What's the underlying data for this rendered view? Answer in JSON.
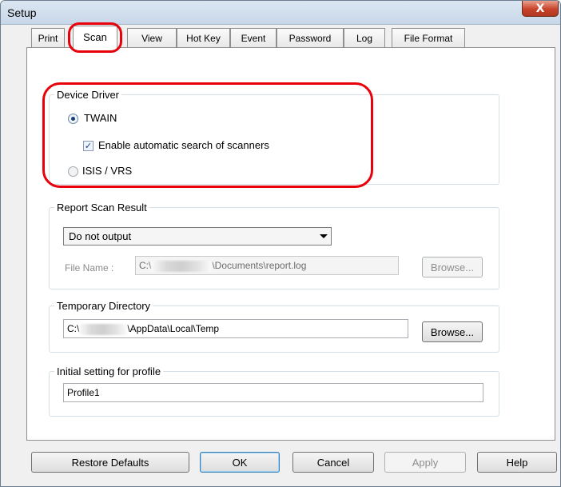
{
  "window": {
    "title": "Setup",
    "close_label": "X"
  },
  "tabs": [
    {
      "label": "Print"
    },
    {
      "label": "Scan"
    },
    {
      "label": "View"
    },
    {
      "label": "Hot Key"
    },
    {
      "label": "Event"
    },
    {
      "label": "Password"
    },
    {
      "label": "Log"
    },
    {
      "label": "File Format"
    }
  ],
  "active_tab": "Scan",
  "device_driver": {
    "legend": "Device Driver",
    "twain_label": "TWAIN",
    "twain_selected": true,
    "auto_search_label": "Enable automatic search of scanners",
    "auto_search_checked": true,
    "isis_label": "ISIS / VRS",
    "isis_selected": false
  },
  "report_scan_result": {
    "legend": "Report Scan Result",
    "output_selected": "Do not output",
    "file_name_label": "File Name :",
    "file_path_prefix": "C:\\",
    "file_path_suffix": "\\Documents\\report.log",
    "browse_label": "Browse..."
  },
  "temporary_directory": {
    "legend": "Temporary Directory",
    "path_prefix": "C:\\",
    "path_suffix": "\\AppData\\Local\\Temp",
    "browse_label": "Browse..."
  },
  "initial_profile": {
    "legend": "Initial setting for profile",
    "value": "Profile1"
  },
  "buttons": {
    "restore_defaults": "Restore Defaults",
    "ok": "OK",
    "cancel": "Cancel",
    "apply": "Apply",
    "help": "Help"
  },
  "highlight_color": "#e8000b"
}
